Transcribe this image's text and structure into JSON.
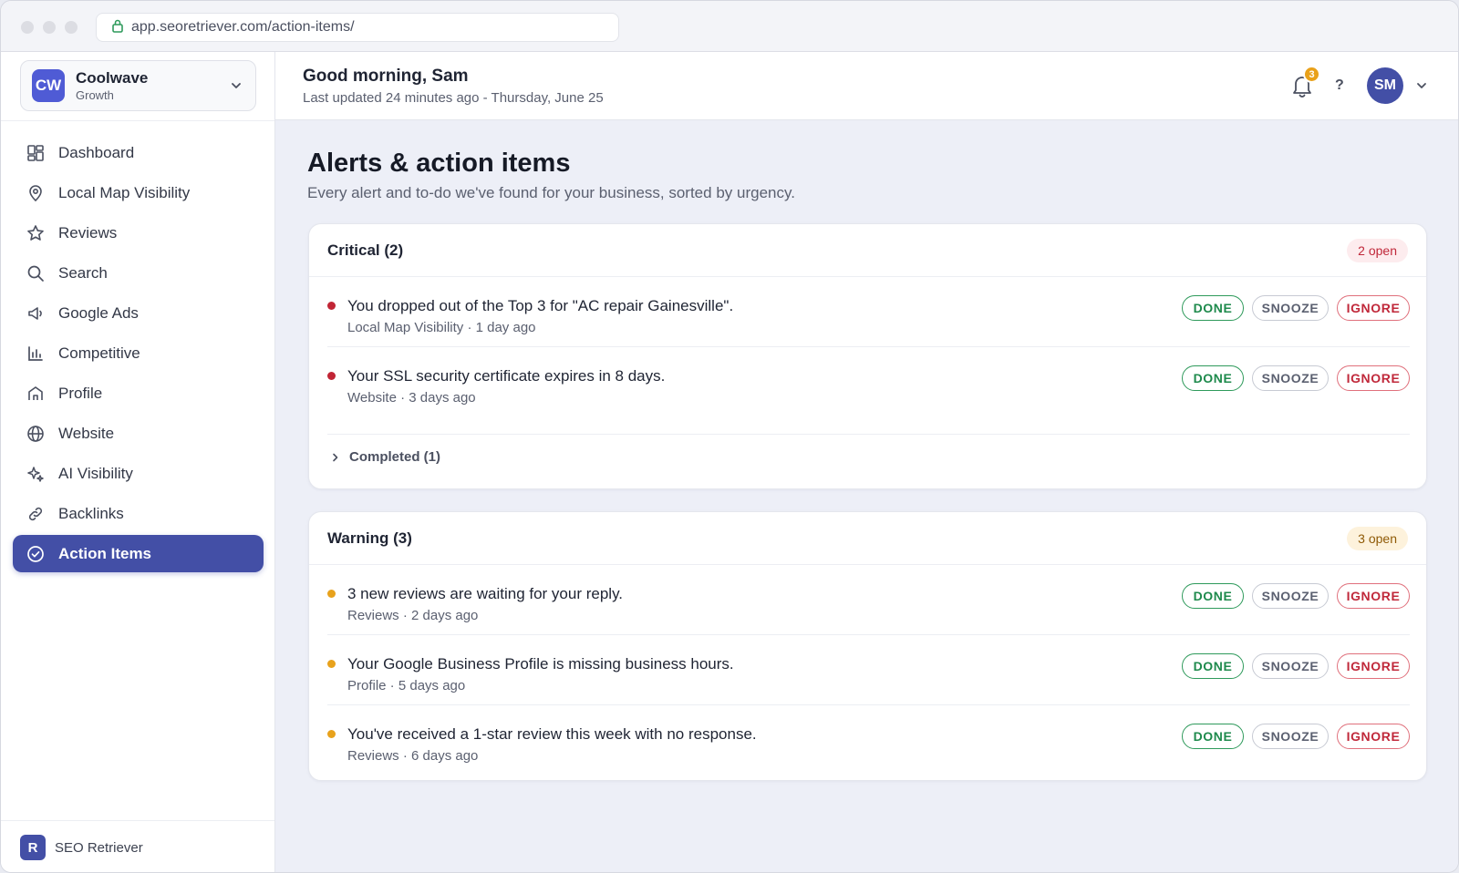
{
  "browser": {
    "url": "app.seoretriever.com/action-items/"
  },
  "workspace": {
    "logo": "CW",
    "name": "Coolwave",
    "plan": "Growth"
  },
  "nav": [
    {
      "label": "Dashboard",
      "icon": "dashboard-icon"
    },
    {
      "label": "Local Map Visibility",
      "icon": "map-pin-icon"
    },
    {
      "label": "Reviews",
      "icon": "star-icon"
    },
    {
      "label": "Search",
      "icon": "search-icon"
    },
    {
      "label": "Google Ads",
      "icon": "megaphone-icon"
    },
    {
      "label": "Competitive",
      "icon": "bar-chart-icon"
    },
    {
      "label": "Profile",
      "icon": "storefront-icon"
    },
    {
      "label": "Website",
      "icon": "globe-icon"
    },
    {
      "label": "AI Visibility",
      "icon": "sparkle-icon"
    },
    {
      "label": "Backlinks",
      "icon": "link-icon"
    },
    {
      "label": "Action Items",
      "icon": "check-circle-icon",
      "active": true
    }
  ],
  "footer": {
    "logo": "R",
    "name": "SEO Retriever"
  },
  "header": {
    "greeting": "Good morning, Sam",
    "updated": "Last updated 24 minutes ago  -  Thursday, June 25",
    "notifications": "3",
    "help": "?",
    "avatar": "SM"
  },
  "page": {
    "title": "Alerts & action items",
    "subtitle": "Every alert and to-do we've found for your business, sorted by urgency."
  },
  "buttons": {
    "done": "DONE",
    "snooze": "SNOOZE",
    "ignore": "IGNORE"
  },
  "critical": {
    "title": "Critical (2)",
    "badge": "2 open",
    "items": [
      {
        "message": "You dropped out of the Top 3 for \"AC repair Gainesville\".",
        "meta": "Local Map Visibility · 1 day ago"
      },
      {
        "message": "Your SSL security certificate expires in 8 days.",
        "meta": "Website · 3 days ago"
      }
    ],
    "completed": "Completed (1)"
  },
  "warning": {
    "title": "Warning (3)",
    "badge": "3 open",
    "items": [
      {
        "message": "3 new reviews are waiting for your reply.",
        "meta": "Reviews · 2 days ago"
      },
      {
        "message": "Your Google Business Profile is missing business hours.",
        "meta": "Profile · 5 days ago"
      },
      {
        "message": "You've received a 1-star review this week with no response.",
        "meta": "Reviews · 6 days ago"
      }
    ]
  },
  "colors": {
    "accent": "#434fa6",
    "critical": "#c12535",
    "warning": "#e8a21c",
    "done": "#1e8a4c"
  }
}
